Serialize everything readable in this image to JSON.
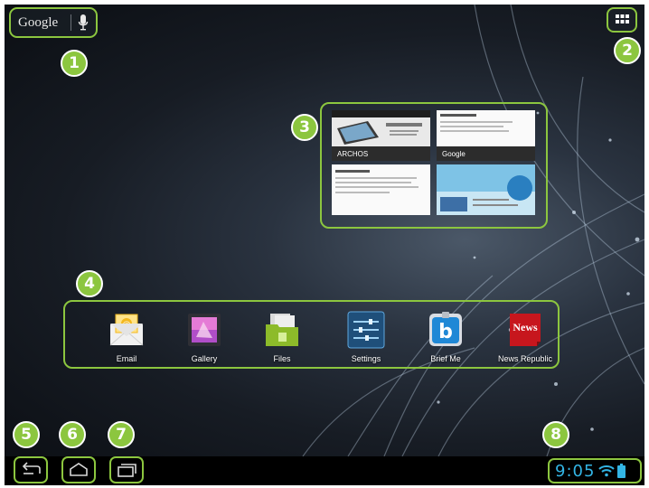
{
  "search": {
    "google_label": "Google"
  },
  "recent_apps": [
    {
      "label": "ARCHOS"
    },
    {
      "label": "Google"
    }
  ],
  "dock": {
    "apps": [
      {
        "label": "Email",
        "icon": "email-icon"
      },
      {
        "label": "Gallery",
        "icon": "gallery-icon"
      },
      {
        "label": "Files",
        "icon": "files-icon"
      },
      {
        "label": "Settings",
        "icon": "settings-icon"
      },
      {
        "label": "Brief Me",
        "icon": "brief-me-icon"
      },
      {
        "label": "News Republic",
        "icon": "news-republic-icon"
      }
    ]
  },
  "news_icon_text": "News",
  "status": {
    "time": "9:05"
  },
  "callouts": [
    "1",
    "2",
    "3",
    "4",
    "5",
    "6",
    "7",
    "8"
  ],
  "colors": {
    "highlight": "#8cc63f",
    "clock": "#33b5e5",
    "navbar": "#000000"
  }
}
